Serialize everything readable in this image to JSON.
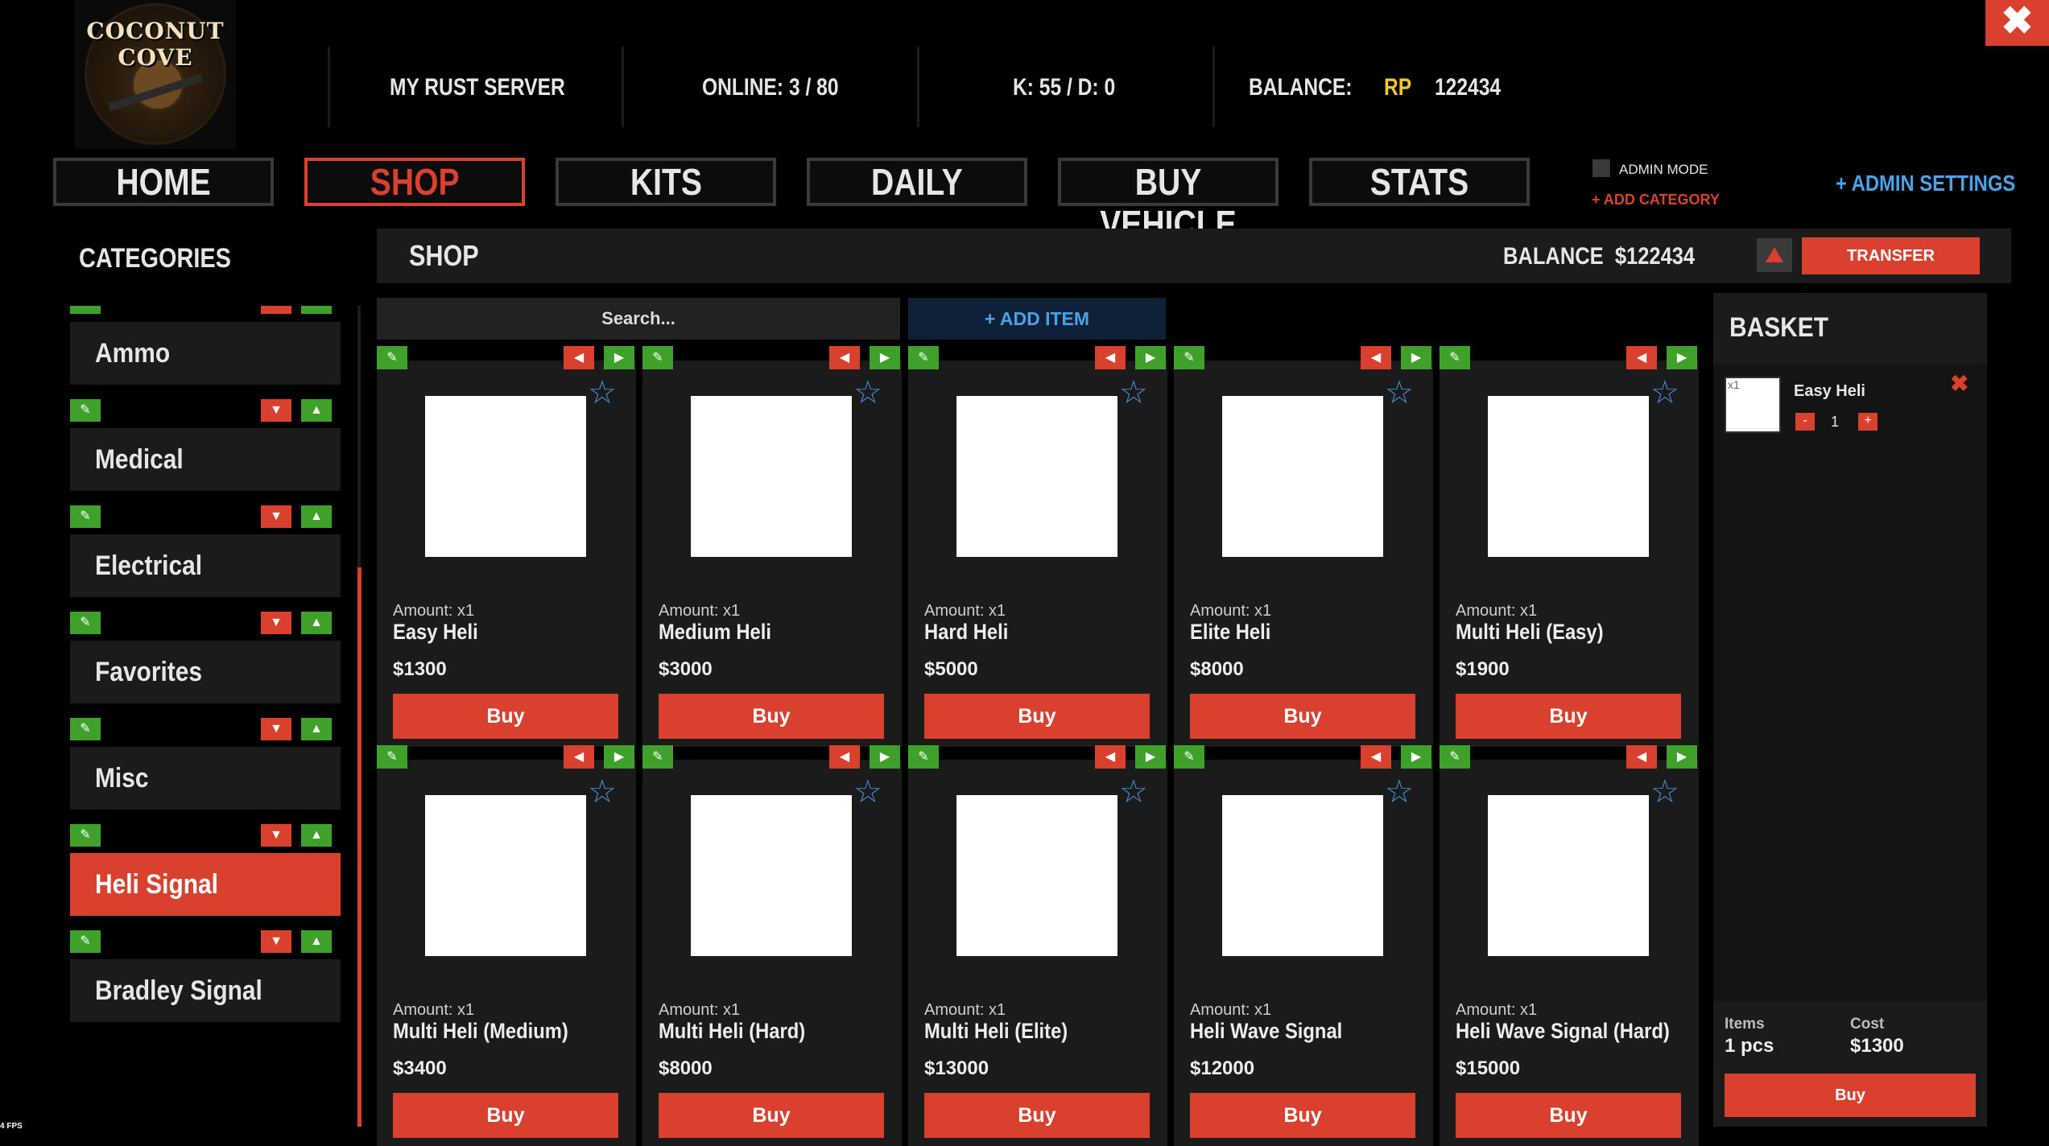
{
  "logo_text": "COCONUT COVE",
  "header": {
    "server_name": "MY RUST SERVER",
    "online": "ONLINE: 3 / 80",
    "kd": "K: 55  / D: 0",
    "balance_label": "BALANCE:",
    "currency": "RP",
    "balance_value": "122434",
    "close_icon": "✖"
  },
  "nav": [
    "HOME",
    "SHOP",
    "KITS",
    "DAILY",
    "BUY VEHICLE",
    "STATS"
  ],
  "admin": {
    "mode_label": "ADMIN MODE",
    "add_category": "+ ADD CATEGORY",
    "settings": "+ ADMIN SETTINGS"
  },
  "categories": {
    "title": "CATEGORIES",
    "items": [
      "Ammo",
      "Medical",
      "Electrical",
      "Favorites",
      "Misc",
      "Heli Signal",
      "Bradley Signal"
    ],
    "active": "Heli Signal"
  },
  "shop": {
    "title": "SHOP",
    "balance_label": "BALANCE",
    "balance_value": "$122434",
    "transfer_label": "TRANSFER",
    "search_placeholder": "Search...",
    "add_item_label": "+ ADD ITEM",
    "buy_label": "Buy",
    "items": [
      {
        "amount": "Amount: x1",
        "name": "Easy Heli",
        "price": "$1300"
      },
      {
        "amount": "Amount: x1",
        "name": "Medium Heli",
        "price": "$3000"
      },
      {
        "amount": "Amount: x1",
        "name": "Hard Heli",
        "price": "$5000"
      },
      {
        "amount": "Amount: x1",
        "name": "Elite Heli",
        "price": "$8000"
      },
      {
        "amount": "Amount: x1",
        "name": "Multi Heli (Easy)",
        "price": "$1900"
      },
      {
        "amount": "Amount: x1",
        "name": "Multi Heli (Medium)",
        "price": "$3400"
      },
      {
        "amount": "Amount: x1",
        "name": "Multi Heli (Hard)",
        "price": "$8000"
      },
      {
        "amount": "Amount: x1",
        "name": "Multi Heli (Elite)",
        "price": "$13000"
      },
      {
        "amount": "Amount: x1",
        "name": "Heli Wave Signal",
        "price": "$12000"
      },
      {
        "amount": "Amount: x1",
        "name": "Heli Wave Signal (Hard)",
        "price": "$15000"
      }
    ]
  },
  "basket": {
    "title": "BASKET",
    "item": {
      "tag": "x1",
      "name": "Easy Heli",
      "qty": "1",
      "minus": "-",
      "plus": "+",
      "remove": "✖"
    },
    "items_label": "Items",
    "items_value": "1 pcs",
    "cost_label": "Cost",
    "cost_value": "$1300",
    "buy_label": "Buy"
  },
  "fps": "4 FPS",
  "colors": {
    "accent": "#d9412e",
    "green": "#3fa12a",
    "blue": "#4aa3e8",
    "gold": "#f2c526"
  }
}
